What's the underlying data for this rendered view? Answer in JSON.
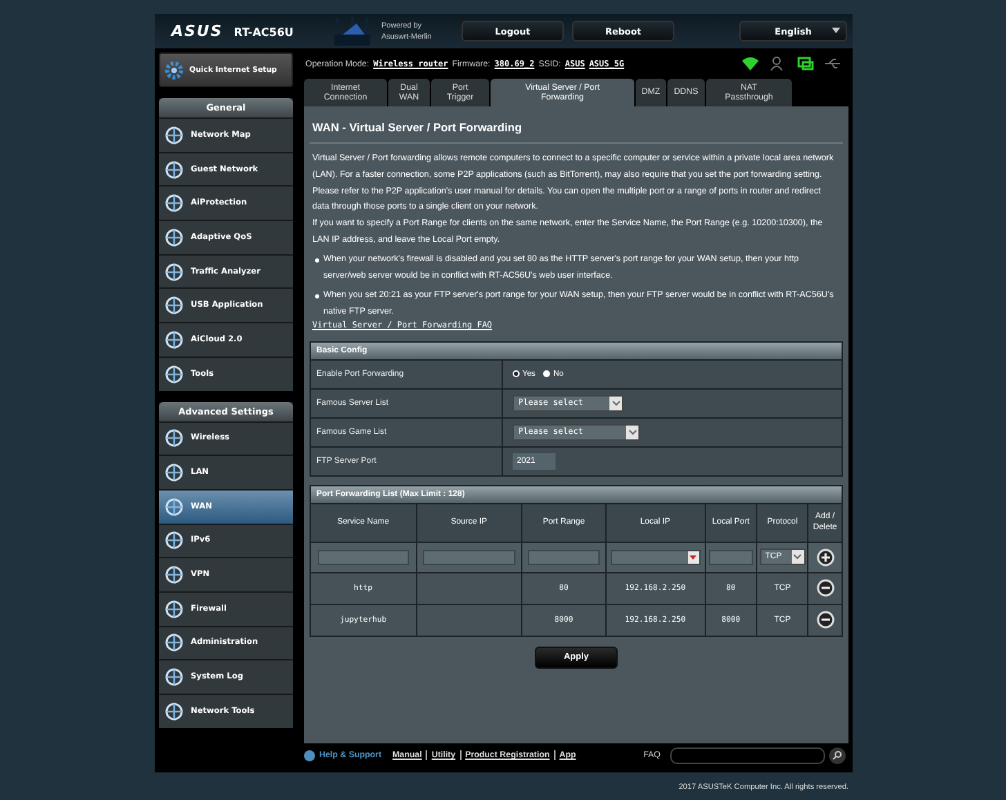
{
  "header": {
    "logo": "ASUS",
    "model": "RT-AC56U",
    "powered_by": "Powered by",
    "firmware_brand": "Asuswrt-Merlin",
    "buttons": [
      "Logout",
      "Reboot"
    ],
    "language": "English"
  },
  "status": {
    "mode_label": "Operation Mode:",
    "mode": "Wireless router",
    "firmware_label": "Firmware:",
    "firmware": "380.69_2",
    "ssid_label": "SSID:",
    "ssids": [
      "ASUS",
      "ASUS_5G"
    ]
  },
  "quick_setup": "Quick Internet Setup",
  "sidebar": [
    {
      "title": "General",
      "items": [
        {
          "label": "Network Map",
          "selected": false
        },
        {
          "label": "Guest Network",
          "selected": false
        },
        {
          "label": "AiProtection",
          "selected": false
        },
        {
          "label": "Adaptive QoS",
          "selected": false
        },
        {
          "label": "Traffic Analyzer",
          "selected": false
        },
        {
          "label": "USB Application",
          "selected": false
        },
        {
          "label": "AiCloud 2.0",
          "selected": false
        },
        {
          "label": "Tools",
          "selected": false
        }
      ]
    },
    {
      "title": "Advanced Settings",
      "items": [
        {
          "label": "Wireless",
          "selected": false
        },
        {
          "label": "LAN",
          "selected": false
        },
        {
          "label": "WAN",
          "selected": true
        },
        {
          "label": "IPv6",
          "selected": false
        },
        {
          "label": "VPN",
          "selected": false
        },
        {
          "label": "Firewall",
          "selected": false
        },
        {
          "label": "Administration",
          "selected": false
        },
        {
          "label": "System Log",
          "selected": false
        },
        {
          "label": "Network Tools",
          "selected": false
        }
      ]
    }
  ],
  "tabs": [
    {
      "lines": [
        "Internet",
        "Connection"
      ],
      "selected": false
    },
    {
      "lines": [
        "Dual",
        "WAN"
      ],
      "selected": false
    },
    {
      "lines": [
        "Port",
        "Trigger"
      ],
      "selected": false
    },
    {
      "lines": [
        "Virtual Server / Port",
        "Forwarding"
      ],
      "selected": true
    },
    {
      "lines": [
        "DMZ"
      ],
      "selected": false
    },
    {
      "lines": [
        "DDNS"
      ],
      "selected": false
    },
    {
      "lines": [
        "NAT",
        "Passthrough"
      ],
      "selected": false
    }
  ],
  "title": "WAN - Virtual Server / Port Forwarding",
  "paragraphs": [
    "Virtual Server / Port forwarding allows remote computers to connect to a specific computer or service within a private local area network (LAN). For a faster connection, some P2P applications (such as BitTorrent), may also require that you set the port forwarding setting. Please refer to the P2P application's user manual for details. You can open the multiple port or a range of ports in router and redirect data through those ports to a single client on your network.",
    "If you want to specify a Port Range for clients on the same network, enter the Service Name, the Port Range (e.g. 10200:10300), the LAN IP address, and leave the Local Port empty."
  ],
  "bullets": [
    "When your network's firewall is disabled and you set 80 as the HTTP server's port range for your WAN setup, then your http server/web server would be in conflict with RT-AC56U's web user interface.",
    "When you set 20:21 as your FTP server's port range for your WAN setup, then your FTP server would be in conflict with RT-AC56U's native FTP server."
  ],
  "faq_link": "Virtual Server / Port Forwarding FAQ",
  "basic_config": {
    "title": "Basic Config",
    "rows": [
      {
        "kind": "radio",
        "label": "Enable Port Forwarding",
        "options": [
          {
            "label": "Yes",
            "selected": true
          },
          {
            "label": "No",
            "selected": false
          }
        ]
      },
      {
        "kind": "select",
        "label": "Famous Server List",
        "value": "Please select"
      },
      {
        "kind": "select",
        "label": "Famous Game List",
        "value": "Please select"
      },
      {
        "kind": "text",
        "label": "FTP Server Port",
        "value": "2021"
      }
    ]
  },
  "port_list": {
    "title": "Port Forwarding List (Max Limit : 128)",
    "columns": [
      "Service Name",
      "Source IP",
      "Port Range",
      "Local IP",
      "Local Port",
      "Protocol",
      [
        "Add /",
        "Delete"
      ]
    ],
    "new_protocol": "TCP",
    "rows": [
      {
        "service": "http",
        "source_ip": "",
        "port_range": "80",
        "local_ip": "192.168.2.250",
        "local_port": "80",
        "protocol": "TCP"
      },
      {
        "service": "jupyterhub",
        "source_ip": "",
        "port_range": "8000",
        "local_ip": "192.168.2.250",
        "local_port": "8000",
        "protocol": "TCP"
      }
    ]
  },
  "apply": "Apply",
  "footer": {
    "help": "Help & Support",
    "links": [
      "Manual",
      "Utility",
      "Product Registration",
      "App"
    ],
    "faq_label": "FAQ",
    "copyright": "2017 ASUSTeK Computer Inc. All rights reserved."
  }
}
